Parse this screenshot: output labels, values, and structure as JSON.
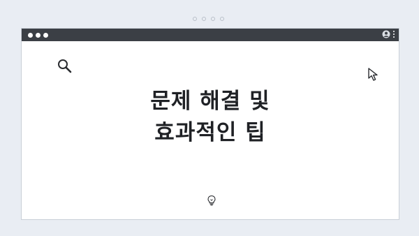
{
  "page": {
    "headline_line1": "문제 해결 및",
    "headline_line2": "효과적인 팁"
  },
  "icons": {
    "search": "magnifier",
    "cursor": "arrow-pointer",
    "bulb": "lightbulb",
    "profile": "user-avatar",
    "menu": "kebab-menu"
  },
  "colors": {
    "background": "#e9edf3",
    "titlebar": "#3b3f45",
    "window": "#ffffff",
    "text": "#1f2125"
  }
}
